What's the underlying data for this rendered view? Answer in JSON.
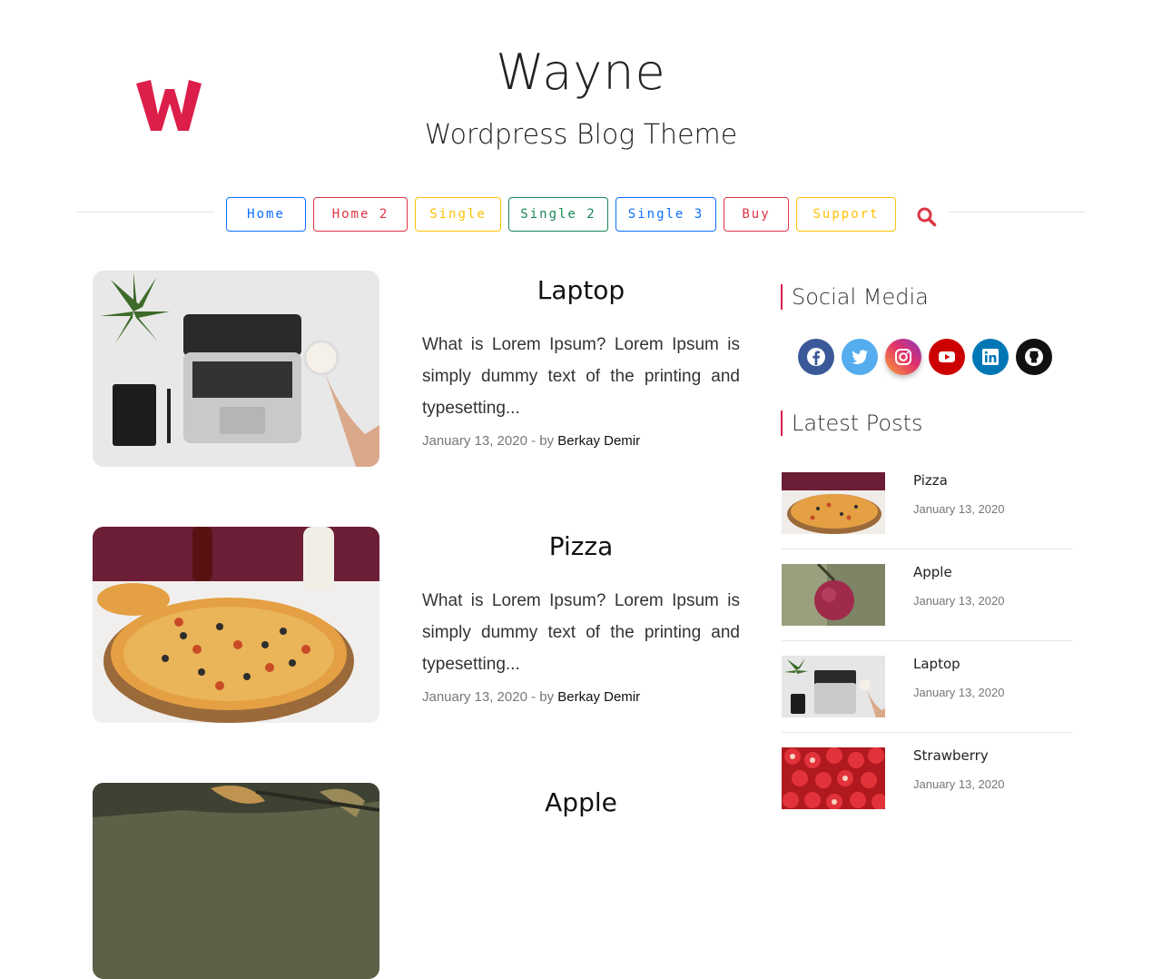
{
  "site": {
    "title": "Wayne",
    "tagline": "Wordpress Blog Theme",
    "brand_color": "#dc1e4a"
  },
  "nav": {
    "items": [
      {
        "label": "Home",
        "color": "#0d6efd"
      },
      {
        "label": "Home 2",
        "color": "#dc3545"
      },
      {
        "label": "Single",
        "color": "#ffc107"
      },
      {
        "label": "Single 2",
        "color": "#198754"
      },
      {
        "label": "Single 3",
        "color": "#0d6efd"
      },
      {
        "label": "Buy",
        "color": "#dc3545"
      },
      {
        "label": "Support",
        "color": "#ffc107"
      }
    ],
    "search_icon": "search-icon"
  },
  "posts": [
    {
      "title": "Laptop",
      "excerpt": "What is Lorem Ipsum? Lorem Ipsum is simply dummy text of the printing and typesetting...",
      "date": "January 13, 2020",
      "by": " - by ",
      "author": "Berkay Demir"
    },
    {
      "title": "Pizza",
      "excerpt": "What is Lorem Ipsum? Lorem Ipsum is simply dummy text of the printing and typesetting...",
      "date": "January 13, 2020",
      "by": " - by ",
      "author": "Berkay Demir"
    },
    {
      "title": "Apple"
    }
  ],
  "sidebar": {
    "social_title": "Social Media",
    "social": [
      {
        "name": "facebook-icon",
        "color": "#3b5998"
      },
      {
        "name": "twitter-icon",
        "color": "#55acee"
      },
      {
        "name": "instagram-icon",
        "color": "#e1306c"
      },
      {
        "name": "youtube-icon",
        "color": "#cc0000"
      },
      {
        "name": "linkedin-icon",
        "color": "#0077b5"
      },
      {
        "name": "github-icon",
        "color": "#111111"
      }
    ],
    "latest_title": "Latest Posts",
    "latest": [
      {
        "title": "Pizza",
        "date": "January 13, 2020"
      },
      {
        "title": "Apple",
        "date": "January 13, 2020"
      },
      {
        "title": "Laptop",
        "date": "January 13, 2020"
      },
      {
        "title": "Strawberry",
        "date": "January 13, 2020"
      }
    ]
  }
}
